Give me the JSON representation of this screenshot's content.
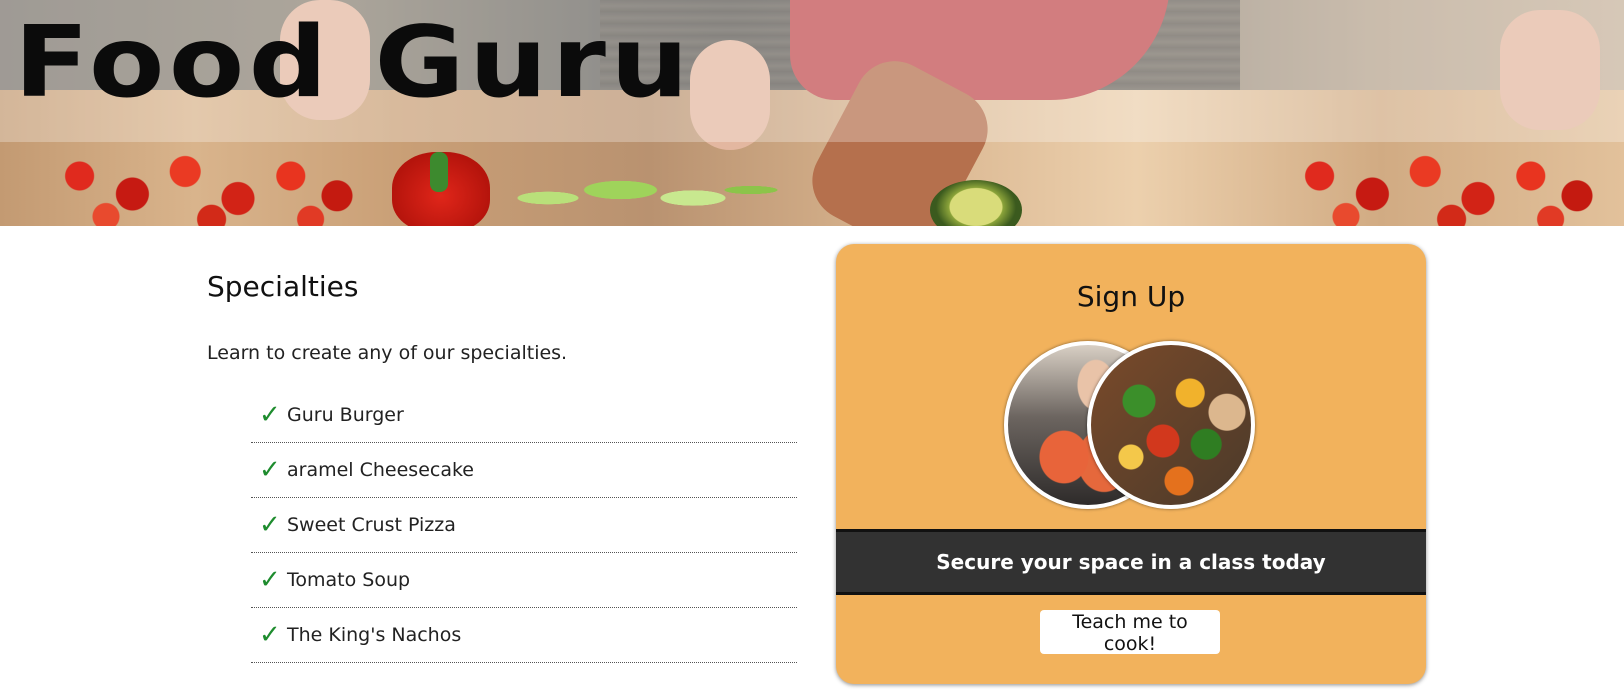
{
  "header": {
    "logo_text": "Food Guru"
  },
  "specialties": {
    "title": "Specialties",
    "intro": "Learn to create any of our specialties.",
    "check_icon": "✓",
    "items": [
      {
        "label": "Guru Burger"
      },
      {
        "label": "aramel Cheesecake"
      },
      {
        "label": "Sweet Crust Pizza"
      },
      {
        "label": "Tomato Soup"
      },
      {
        "label": "The King's Nachos"
      }
    ]
  },
  "signup": {
    "title": "Sign Up",
    "tagline": "Secure your space in a class today",
    "button_label": "Teach me to cook!"
  },
  "colors": {
    "card_background": "#f2b25c",
    "band_background": "#323232",
    "check_color": "#1e8c2e"
  }
}
